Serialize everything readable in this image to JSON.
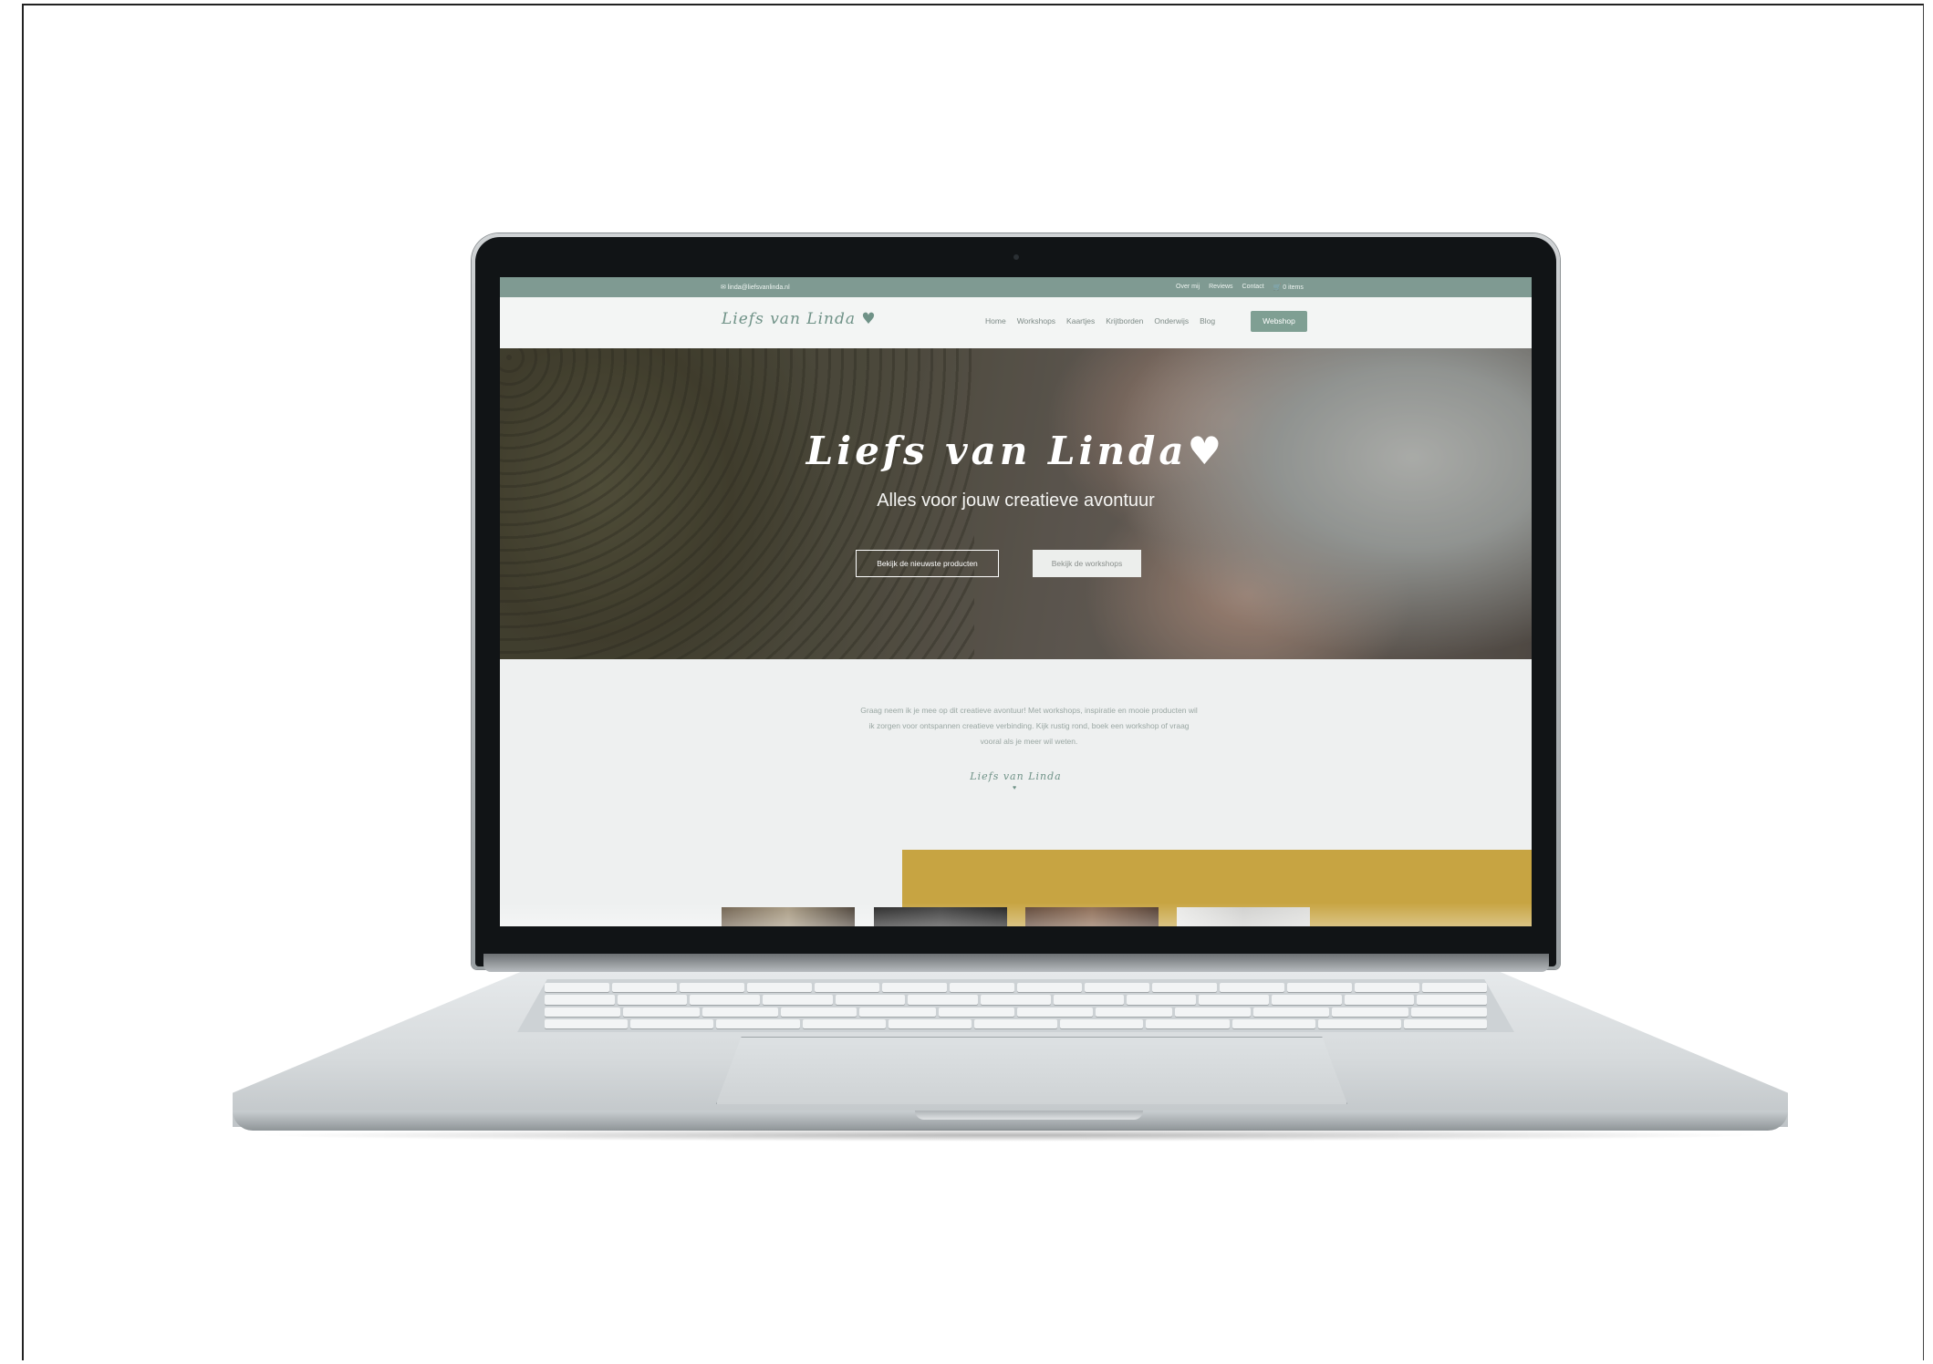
{
  "website": {
    "topbar": {
      "email": "✉ linda@liefsvanlinda.nl",
      "links": [
        "Over mij",
        "Reviews",
        "Contact"
      ],
      "cart": "🛒 0 items"
    },
    "logo": "Liefs van Linda ♥",
    "nav": [
      "Home",
      "Workshops",
      "Kaartjes",
      "Krijtborden",
      "Onderwijs",
      "Blog"
    ],
    "nav_cta": "Webshop",
    "hero": {
      "title": "Liefs van Linda♥",
      "subtitle": "Alles voor jouw creatieve avontuur",
      "button_primary": "Bekijk de nieuwste producten",
      "button_secondary": "Bekijk de workshops"
    },
    "intro": {
      "lines": [
        "Graag neem ik je mee op dit creatieve avontuur! Met workshops, inspiratie en mooie producten wil",
        "ik zorgen voor ontspannen creatieve verbinding. Kijk rustig rond, boek een workshop of vraag",
        "vooral als je meer wil weten."
      ],
      "signature": "Liefs van Linda",
      "signature_heart": "♥"
    }
  },
  "colors": {
    "accent_green": "#7f9f93",
    "logo_green": "#6f9287",
    "mustard": "#c7a442",
    "bezel": "#111416"
  }
}
